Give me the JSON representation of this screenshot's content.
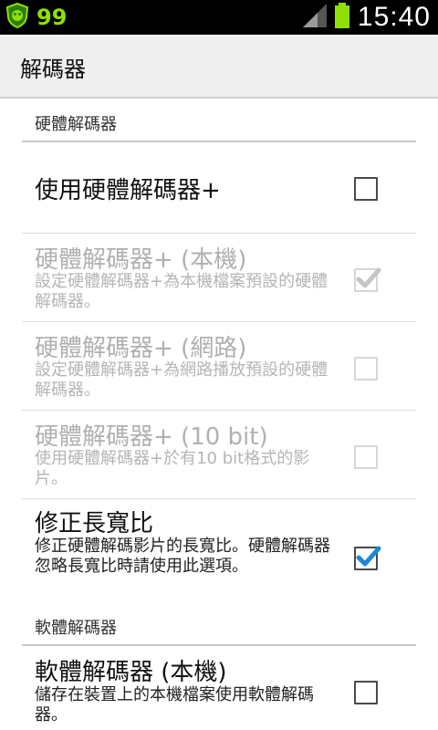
{
  "status_bar": {
    "notification_count": "99",
    "time": "15:40",
    "icons": {
      "app": "shield-bug-icon",
      "signal": "signal-icon",
      "battery": "battery-icon"
    },
    "colors": {
      "count": "#8ee000",
      "battery": "#8ee000"
    }
  },
  "header": {
    "title": "解碼器"
  },
  "sections": [
    {
      "label": "硬體解碼器",
      "items": [
        {
          "title": "使用硬體解碼器+",
          "summary": "",
          "checked": false,
          "enabled": true
        },
        {
          "title": "硬體解碼器+ (本機)",
          "summary": "設定硬體解碼器+為本機檔案預設的硬體解碼器。",
          "checked": true,
          "enabled": false
        },
        {
          "title": "硬體解碼器+ (網路)",
          "summary": "設定硬體解碼器+為網路播放預設的硬體解碼器。",
          "checked": false,
          "enabled": false
        },
        {
          "title": "硬體解碼器+ (10 bit)",
          "summary": "使用硬體解碼器+於有10 bit格式的影片。",
          "checked": false,
          "enabled": false
        },
        {
          "title": "修正長寬比",
          "summary": "修正硬體解碼影片的長寬比。硬體解碼器忽略長寬比時請使用此選項。",
          "checked": true,
          "enabled": true
        }
      ]
    },
    {
      "label": "軟體解碼器",
      "items": [
        {
          "title": "軟體解碼器 (本機)",
          "summary": "儲存在裝置上的本機檔案使用軟體解碼器。",
          "checked": false,
          "enabled": true
        }
      ]
    }
  ],
  "colors": {
    "check_enabled": "#1e88d6",
    "check_disabled": "#c4c4c4"
  }
}
